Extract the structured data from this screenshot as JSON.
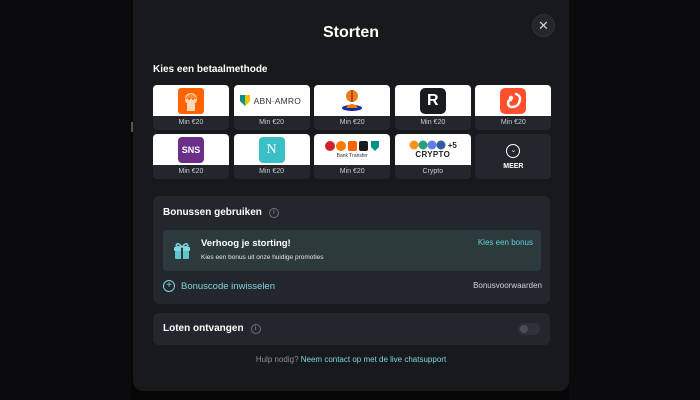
{
  "modal": {
    "title": "Storten",
    "close_symbol": "✕"
  },
  "payment": {
    "heading": "Kies een betaalmethode",
    "methods": [
      {
        "name": "ING",
        "caption": "Min €20",
        "icon": "ing-lion-icon"
      },
      {
        "name": "ABN·AMRO",
        "caption": "Min €20",
        "icon": "abn-amro-shield-icon"
      },
      {
        "name": "Rabobank",
        "caption": "Min €20",
        "icon": "rabobank-icon"
      },
      {
        "name": "R",
        "caption": "Min €20",
        "icon": "revolut-icon"
      },
      {
        "name": "Squirrel",
        "caption": "Min €20",
        "icon": "squirrel-icon"
      },
      {
        "name": "SNS",
        "caption": "Min €20",
        "icon": "sns-icon"
      },
      {
        "name": "N",
        "caption": "Min €20",
        "icon": "n26-icon"
      },
      {
        "name": "Bank Transfer",
        "caption": "Min €20",
        "icon": "bank-transfer-icon"
      },
      {
        "name": "CRYPTO",
        "plus": "+5",
        "caption": "Crypto",
        "icon": "crypto-coins-icon"
      }
    ],
    "more_label": "MEER",
    "colors": {
      "ing": "#ff6200",
      "abn": "#009286",
      "rabo": "#0f2f93",
      "revolut": "#191c1f",
      "squirrel": "#ff4f2d",
      "sns": "#6b2f8a",
      "n26": "#3bbfc6"
    }
  },
  "bonus": {
    "heading": "Bonussen gebruiken",
    "promo_title": "Verhoog je storting!",
    "promo_subtitle": "Kies een bonus uit onze huidige promoties",
    "promo_link": "Kies een bonus",
    "code_link": "Bonuscode inwisselen",
    "terms_link": "Bonusvoorwaarden"
  },
  "lots": {
    "label": "Loten ontvangen",
    "toggle_on": false
  },
  "help": {
    "prefix": "Hulp nodig?",
    "link": "Neem contact op met de live chatsupport"
  }
}
